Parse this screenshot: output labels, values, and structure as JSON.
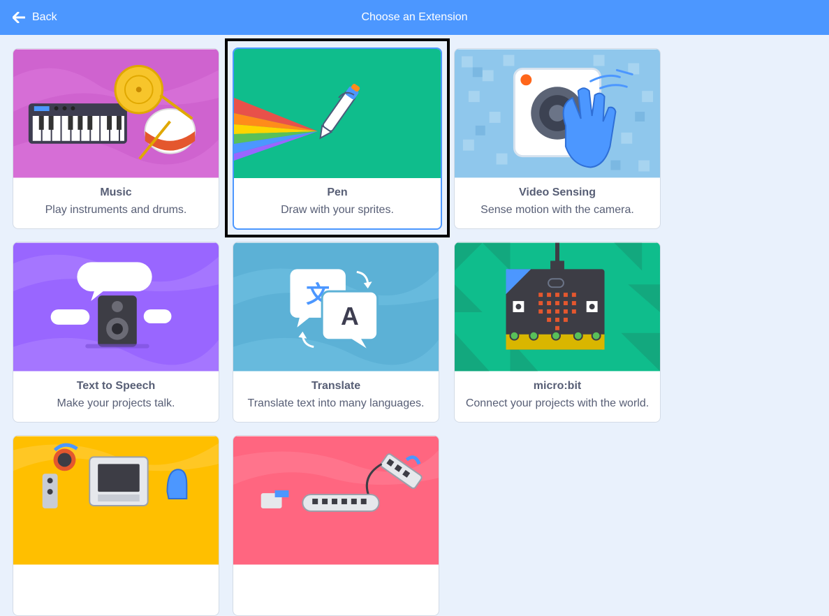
{
  "header": {
    "back_label": "Back",
    "title": "Choose an Extension"
  },
  "extensions": [
    {
      "name": "Music",
      "description": "Play instruments and drums."
    },
    {
      "name": "Pen",
      "description": "Draw with your sprites."
    },
    {
      "name": "Video Sensing",
      "description": "Sense motion with the camera."
    },
    {
      "name": "Text to Speech",
      "description": "Make your projects talk."
    },
    {
      "name": "Translate",
      "description": "Translate text into many languages."
    },
    {
      "name": "micro:bit",
      "description": "Connect your projects with the world."
    }
  ],
  "colors": {
    "header": "#4c97ff",
    "background": "#e9f1fc",
    "music": "#cf63cf",
    "pen": "#0fbd8c",
    "video": "#8fc7ec",
    "tts": "#9966ff",
    "translate": "#5cb1d6",
    "microbit": "#0fbd8c",
    "lego": "#ffbf00",
    "wedo": "#ff6680"
  }
}
